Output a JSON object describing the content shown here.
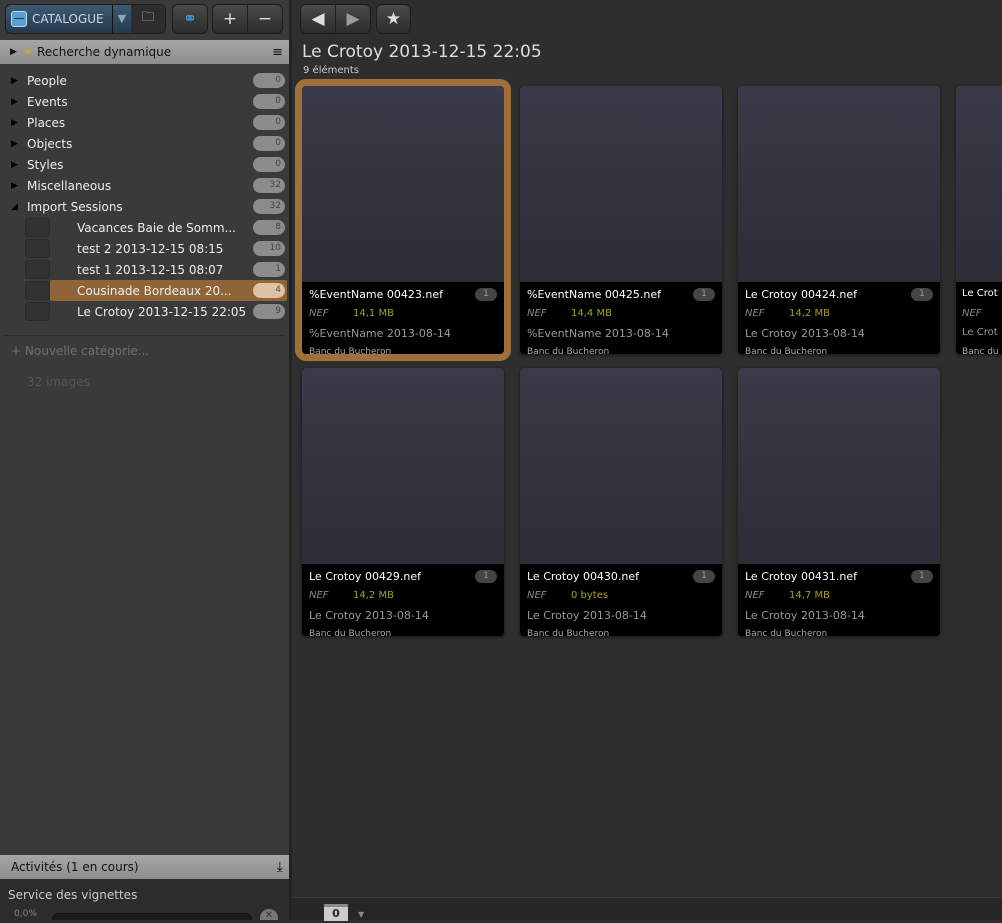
{
  "toolbar": {
    "catalogue_label": "CATALOGUE",
    "dropdown_icon": "▼",
    "folder_icon": "🗀",
    "rings_icon": "⚭",
    "add": "+",
    "remove": "−"
  },
  "nav": {
    "back": "◀",
    "forward": "▶",
    "star": "★"
  },
  "dynamic_search": {
    "label": "Recherche dynamique",
    "menu_icon": "≡",
    "rings": "⚭"
  },
  "tree": [
    {
      "label": "People",
      "count": "0",
      "expanded": false
    },
    {
      "label": "Events",
      "count": "0",
      "expanded": false
    },
    {
      "label": "Places",
      "count": "0",
      "expanded": false
    },
    {
      "label": "Objects",
      "count": "0",
      "expanded": false
    },
    {
      "label": "Styles",
      "count": "0",
      "expanded": false
    },
    {
      "label": "Miscellaneous",
      "count": "32",
      "expanded": false
    },
    {
      "label": "Import Sessions",
      "count": "32",
      "expanded": true
    }
  ],
  "sessions": [
    {
      "label": "Vacances Baie de Somm...",
      "count": "8"
    },
    {
      "label": "test 2 2013-12-15 08:15",
      "count": "10"
    },
    {
      "label": "test 1 2013-12-15 08:07",
      "count": "1"
    },
    {
      "label": "Cousinade Bordeaux 20...",
      "count": "4",
      "selected": true
    },
    {
      "label": "Le Crotoy 2013-12-15 22:05",
      "count": "9"
    }
  ],
  "new_category": "+ Nouvelle catégorie...",
  "image_count": "32 images",
  "activities": {
    "title": "Activités (1 en cours)",
    "service": "Service des vignettes",
    "percent": "0,0%",
    "progress": 0,
    "cancel_icon": "✕",
    "collapse_icon": "⤓"
  },
  "main": {
    "title": "Le Crotoy 2013-12-15 22:05",
    "subtitle": "9 éléments"
  },
  "cards": [
    {
      "file": "%EventName 00423.nef",
      "rank": "1",
      "type": "NEF",
      "size": "14,1 MB",
      "date": "%EventName 2013-08-14",
      "location": "Banc du Bucheron",
      "selected": true
    },
    {
      "file": "%EventName 00425.nef",
      "rank": "1",
      "type": "NEF",
      "size": "14,4 MB",
      "date": "%EventName 2013-08-14",
      "location": "Banc du Bucheron"
    },
    {
      "file": "Le Crotoy 00424.nef",
      "rank": "1",
      "type": "NEF",
      "size": "14,2 MB",
      "date": "Le Crotoy 2013-08-14",
      "location": "Banc du Bucheron"
    },
    {
      "file": "Le Crot",
      "rank": "",
      "type": "NEF",
      "size": "",
      "date": "Le Crot",
      "location": "Banc du"
    },
    {
      "file": "Le Crotoy 00429.nef",
      "rank": "1",
      "type": "NEF",
      "size": "14,2 MB",
      "date": "Le Crotoy 2013-08-14",
      "location": "Banc du Bucheron"
    },
    {
      "file": "Le Crotoy 00430.nef",
      "rank": "1",
      "type": "NEF",
      "size": "0 bytes",
      "date": "Le Crotoy 2013-08-14",
      "location": "Banc du Bucheron"
    },
    {
      "file": "Le Crotoy 00431.nef",
      "rank": "1",
      "type": "NEF",
      "size": "14,7 MB",
      "date": "Le Crotoy 2013-08-14",
      "location": "Banc du Bucheron"
    }
  ],
  "bottom": {
    "zoom_value": "0",
    "dropdown_icon": "▼"
  },
  "colors": {
    "accent": "#a0703a",
    "size_text": "#a8a020",
    "catalogue": "#3c5a74"
  }
}
